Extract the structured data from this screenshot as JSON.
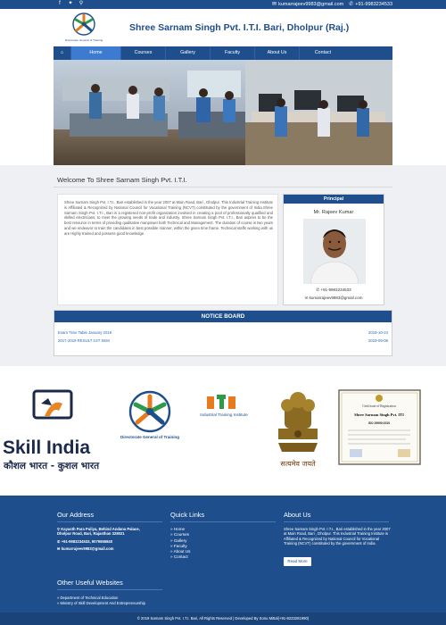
{
  "topbar": {
    "email": "kumarrajeev9983@gmail.com",
    "phone": "+91-9983234533",
    "icons": [
      "facebook-icon",
      "twitter-icon",
      "location-icon",
      "envelope-icon",
      "phone-icon"
    ]
  },
  "header": {
    "title": "Shree Sarnam Singh Pvt. I.T.I. Bari, Dholpur (Raj.)",
    "logo_caption": "Directorate General of Training"
  },
  "nav": {
    "items": [
      "Home",
      "Courses",
      "Gallery",
      "Faculty",
      "About Us",
      "Contact"
    ]
  },
  "welcome": {
    "heading": "Welcome To Shree Sarnam Singh Pvt. I.T.I.",
    "body": "Shree Sarnam Singh Pvt. I.T.I., Bari established in the year 2007 at Main Road, Bari , Dholpur. This Industrial Training Institute is Affiliated & Recognized by National Council for Vocational Training (NCVT) constituted by the government of India.Shree Sarnam Singh Pvt. I.T.I., Bari is a registered non-profit organization involved in creating a pool of professionally qualified and skilled electricians, to meet the growing needs of trade and industry. Shree Sarnam Singh Pvt. I.T.I., Bari aspires to be the best resource in terms of providing qualitative manpower both Technical and Management. The duration of course is two years and we endeavor to train the candidates in best possible manner, within the given time frame. Technical staffs working with us are Highly trained and possess good knowledge."
  },
  "principal": {
    "heading": "Principal",
    "name": "Mr. Rajeev Kumar",
    "phone": "+91-9983234533",
    "email": "kumarrajeev9983@gmail.com"
  },
  "notice_board": {
    "heading": "NOTICE BOARD",
    "items": [
      {
        "title": "Exam Time Table January 2019",
        "date": "2019-10-24"
      },
      {
        "title": "2017-2019 RESULT 1ST SEM",
        "date": "2019-05-06"
      }
    ]
  },
  "partners": {
    "skill_india": "Skill India",
    "skill_india_hindi": "कौशल भारत - कुशल भारत",
    "dgt": "Directorate General of Training",
    "iti": "Industrial Training Institute",
    "emblem_motto": "सत्यमेव जयते",
    "certificate_title": "Certificate of Registration",
    "certificate_name": "Shree Sarnam Singh Pvt. ITI",
    "certificate_standard": "ISO 29990:2010"
  },
  "footer": {
    "address_heading": "Our Address",
    "address_lines": [
      "Kayasth Para Puliya, Behind Andana Palace,",
      "Dholpur Road, Bari, Rajasthan 328021"
    ],
    "phones": "+91-9983234533, 9079655840",
    "email": "kumarrajeev9983@gmail.com",
    "quick_links_heading": "Quick Links",
    "quick_links": [
      "Home",
      "Courses",
      "Gallery",
      "Faculty",
      "About Us",
      "Contact"
    ],
    "about_heading": "About Us",
    "about_text": "Shree Sarnam Singh Pvt. I.T.I., Bari established in the year 2007 at Main Road, Bari , Dholpur. This Industrial Training Institute is Affiliated & Recognized by National Council for Vocational Training (NCVT) constituted by the government of India.",
    "read_more": "Read More",
    "useful_heading": "Other Useful Websites",
    "useful_links": [
      "Department of Technical Education",
      "Ministry of Skill Development And Entrepreneurship"
    ],
    "copyright": "© 2019 Sarnam Singh Pvt. I.T.I. Bari, All Rights Reserved | Developed By Sonu Mittal(+91-8233281990)"
  },
  "colors": {
    "primary": "#1f4e8c",
    "nav_active": "#3d7bd0",
    "link": "#2a6ab8"
  }
}
